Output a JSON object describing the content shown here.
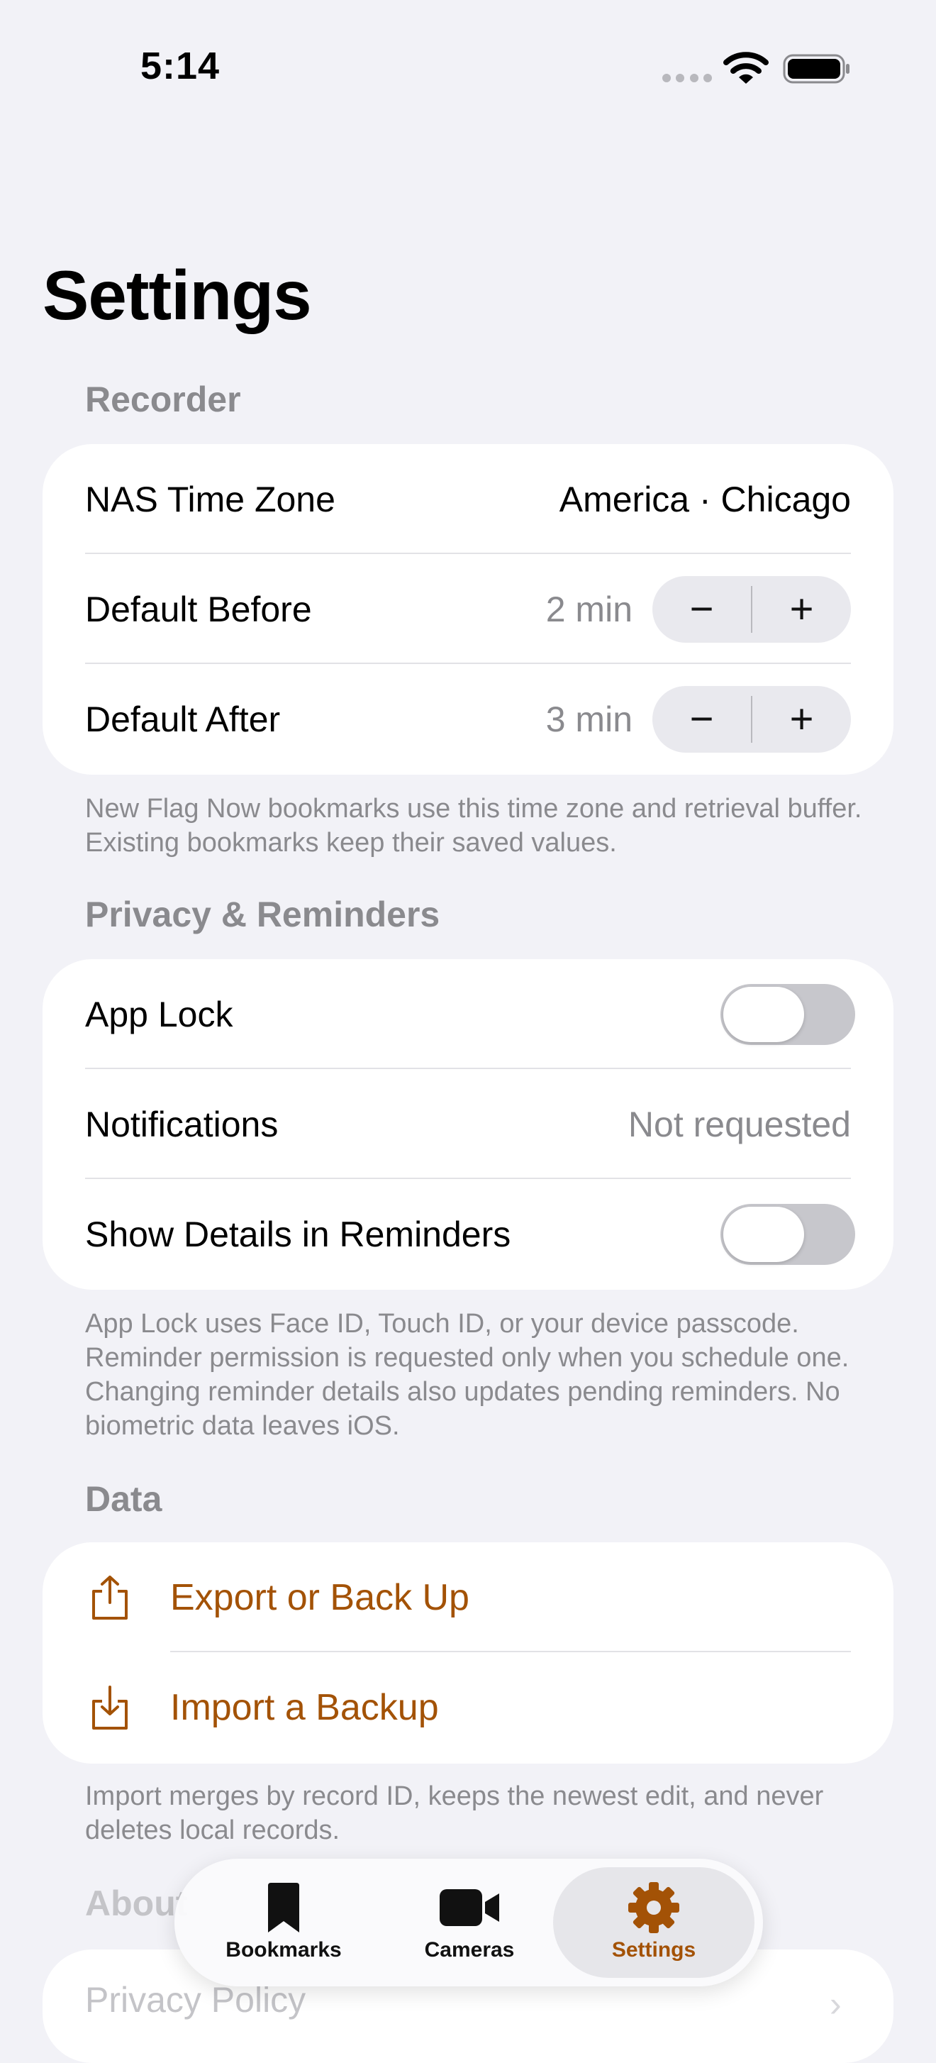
{
  "status_bar": {
    "time": "5:14"
  },
  "title": "Settings",
  "sections": {
    "recorder": {
      "header": "Recorder",
      "nas_time_zone": {
        "label": "NAS Time Zone",
        "value": "America · Chicago"
      },
      "default_before": {
        "label": "Default Before",
        "value": "2 min",
        "minus": "−",
        "plus": "+"
      },
      "default_after": {
        "label": "Default After",
        "value": "3 min",
        "minus": "−",
        "plus": "+"
      },
      "footer": "New Flag Now bookmarks use this time zone and retrieval buffer. Existing bookmarks keep their saved values."
    },
    "privacy": {
      "header": "Privacy & Reminders",
      "app_lock": {
        "label": "App Lock",
        "on": false
      },
      "notifications": {
        "label": "Notifications",
        "value": "Not requested"
      },
      "show_details": {
        "label": "Show Details in Reminders",
        "on": false
      },
      "footer": "App Lock uses Face ID, Touch ID, or your device passcode. Reminder permission is requested only when you schedule one. Changing reminder details also updates pending reminders. No biometric data leaves iOS."
    },
    "data": {
      "header": "Data",
      "export": {
        "label": "Export or Back Up",
        "icon": "share-icon"
      },
      "import": {
        "label": "Import a Backup",
        "icon": "import-icon"
      },
      "footer": "Import merges by record ID, keeps the newest edit, and never deletes local records."
    },
    "about": {
      "header": "About",
      "privacy_policy": "Privacy Policy"
    }
  },
  "tab_bar": {
    "tabs": [
      {
        "label": "Bookmarks",
        "icon": "bookmark-icon",
        "selected": false
      },
      {
        "label": "Cameras",
        "icon": "video-camera-icon",
        "selected": false
      },
      {
        "label": "Settings",
        "icon": "gear-icon",
        "selected": true
      }
    ]
  },
  "colors": {
    "accent": "#a35206",
    "background": "#f2f2f7",
    "secondary_text": "#8a8a8e"
  }
}
